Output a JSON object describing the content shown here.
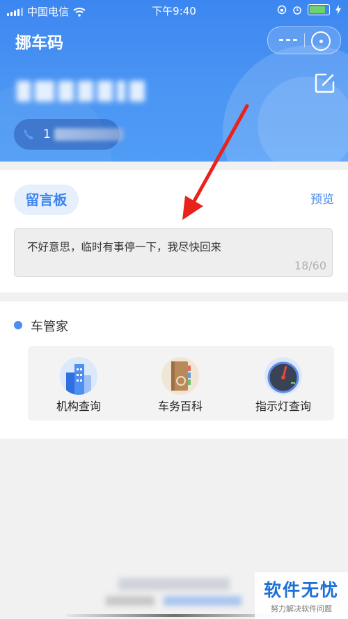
{
  "status_bar": {
    "carrier": "中国电信",
    "time": "下午9:40",
    "icons": [
      "signal-icon",
      "wifi-icon",
      "rotation-lock-icon",
      "alarm-icon",
      "battery-icon",
      "charging-icon"
    ],
    "battery_level": 0.9
  },
  "header": {
    "title": "挪车码",
    "phone_prefix": "1",
    "colors": {
      "top": "#3c86f1",
      "bottom": "#4f9cf6"
    }
  },
  "message_board": {
    "tab_label": "留言板",
    "preview_label": "预览",
    "message": "不好意思，临时有事停一下，我尽快回来",
    "char_count": "18/60",
    "accent": "#3d86f0"
  },
  "car_steward": {
    "title": "车管家",
    "tools": [
      {
        "label": "机构查询",
        "icon": "building-icon"
      },
      {
        "label": "车务百科",
        "icon": "book-icon"
      },
      {
        "label": "指示灯查询",
        "icon": "gauge-icon"
      }
    ]
  },
  "watermark": {
    "title": "软件无忧",
    "subtitle": "努力解决软件问题"
  }
}
